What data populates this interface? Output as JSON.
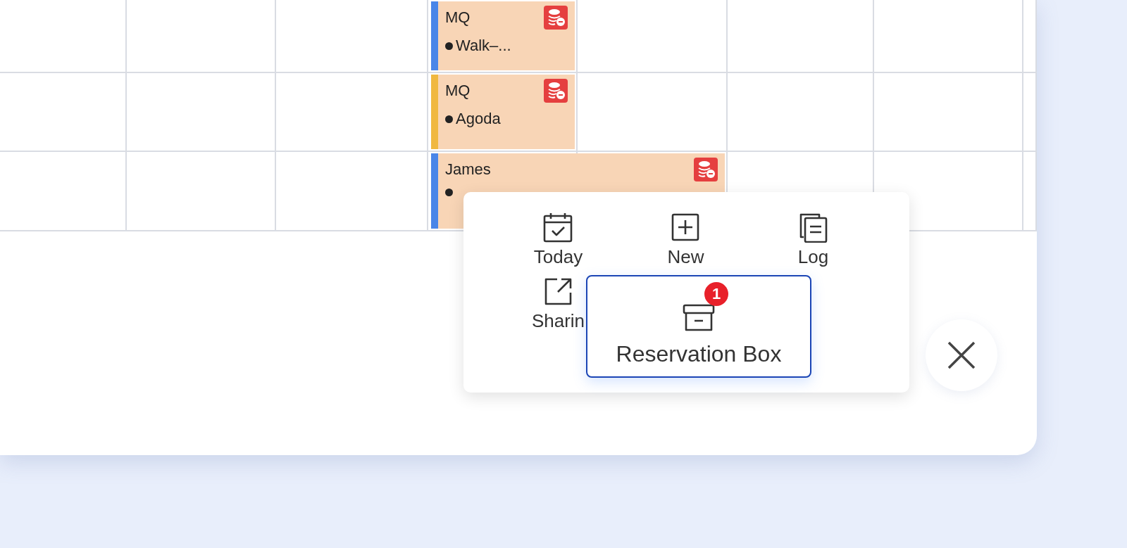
{
  "calendar": {
    "events": [
      {
        "name": "MQ",
        "source": "Walk–...",
        "color": "#4a86e8"
      },
      {
        "name": "MQ",
        "source": "Agoda",
        "color": "#f0b840"
      },
      {
        "name": "James",
        "color": "#4a86e8"
      }
    ]
  },
  "action_menu": {
    "items": [
      {
        "label": "Today",
        "kind": "today"
      },
      {
        "label": "New",
        "kind": "new"
      },
      {
        "label": "Log",
        "kind": "log"
      },
      {
        "label": "Sharin",
        "kind": "share"
      }
    ],
    "highlighted": {
      "label": "Reservation Box",
      "badge": "1",
      "kind": "box"
    }
  },
  "close_button": {
    "kind": "close"
  }
}
